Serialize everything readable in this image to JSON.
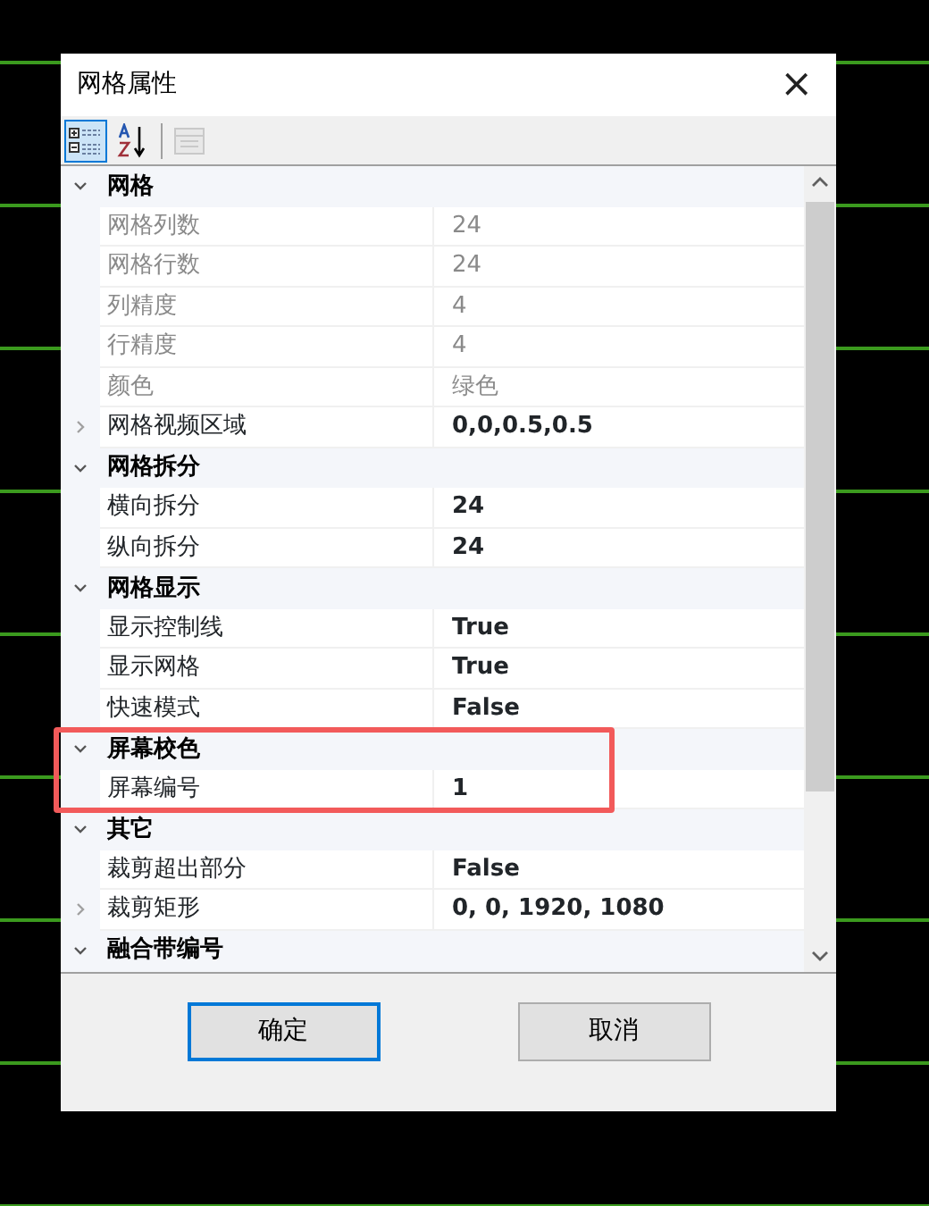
{
  "window": {
    "title": "网格属性",
    "close": "×"
  },
  "toolbar": [
    {
      "kind": "categorized",
      "selected": true
    },
    {
      "kind": "alphabetical",
      "selected": false
    },
    {
      "kind": "pages",
      "selected": false,
      "disabled": true
    }
  ],
  "categories": [
    {
      "name": "网格",
      "expanded": true,
      "properties": [
        {
          "name": "网格列数",
          "value": "24",
          "readonly": true
        },
        {
          "name": "网格行数",
          "value": "24",
          "readonly": true
        },
        {
          "name": "列精度",
          "value": "4",
          "readonly": true
        },
        {
          "name": "行精度",
          "value": "4",
          "readonly": true
        },
        {
          "name": "颜色",
          "value": "绿色",
          "readonly": true
        },
        {
          "name": "网格视频区域",
          "value": "0,0,0.5,0.5",
          "readonly": false,
          "expanded": false
        }
      ]
    },
    {
      "name": "网格拆分",
      "expanded": true,
      "properties": [
        {
          "name": "横向拆分",
          "value": "24",
          "readonly": false
        },
        {
          "name": "纵向拆分",
          "value": "24",
          "readonly": false
        }
      ]
    },
    {
      "name": "网格显示",
      "expanded": true,
      "properties": [
        {
          "name": "显示控制线",
          "value": "True",
          "readonly": false
        },
        {
          "name": "显示网格",
          "value": "True",
          "readonly": false
        },
        {
          "name": "快速模式",
          "value": "False",
          "readonly": false
        }
      ]
    },
    {
      "name": "屏幕校色",
      "expanded": true,
      "highlighted": true,
      "properties": [
        {
          "name": "屏幕编号",
          "value": "1",
          "readonly": false
        }
      ]
    },
    {
      "name": "其它",
      "expanded": true,
      "properties": [
        {
          "name": "裁剪超出部分",
          "value": "False",
          "readonly": false
        },
        {
          "name": "裁剪矩形",
          "value": "0, 0, 1920, 1080",
          "readonly": false,
          "expanded": false
        }
      ]
    },
    {
      "name": "融合带编号",
      "expanded": true
    }
  ],
  "buttons": [
    {
      "label": "确定",
      "default": true
    },
    {
      "label": "取消",
      "default": false
    }
  ]
}
